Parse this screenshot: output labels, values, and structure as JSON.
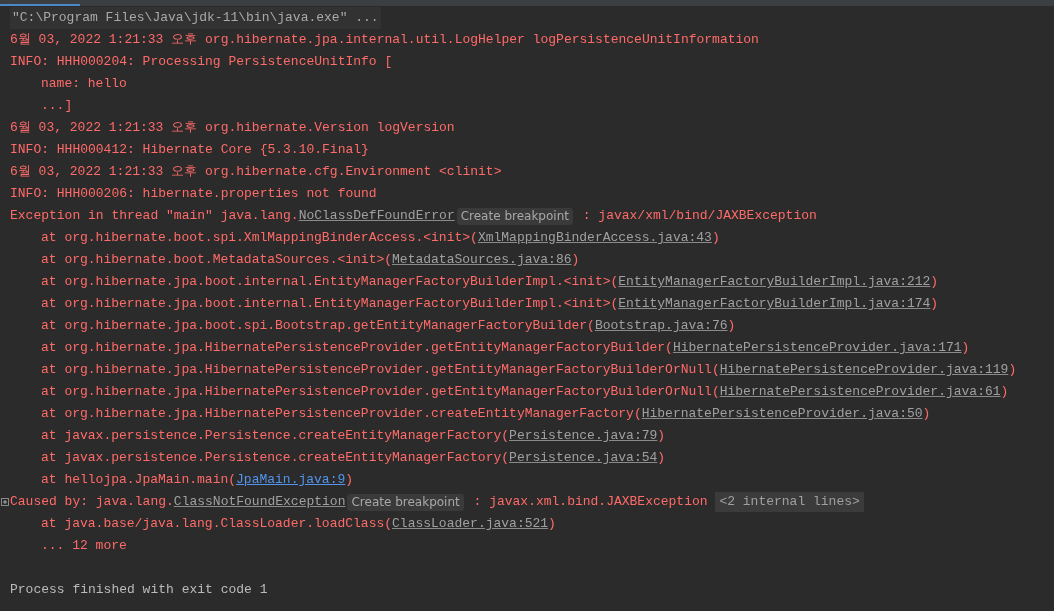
{
  "console": {
    "lines": [
      {
        "kind": "command",
        "parts": [
          {
            "kind": "text",
            "text": "\"C:\\Program Files\\Java\\jdk-11\\bin\\java.exe\" ..."
          }
        ]
      },
      {
        "kind": "error",
        "parts": [
          {
            "kind": "text",
            "text": "6월 03, 2022 1:21:33 오후 org.hibernate.jpa.internal.util.LogHelper logPersistenceUnitInformation"
          }
        ]
      },
      {
        "kind": "error",
        "parts": [
          {
            "kind": "text",
            "text": "INFO: HHH000204: Processing PersistenceUnitInfo ["
          }
        ]
      },
      {
        "kind": "frame",
        "parts": [
          {
            "kind": "text",
            "text": "name: hello"
          }
        ]
      },
      {
        "kind": "frame",
        "parts": [
          {
            "kind": "text",
            "text": "...]"
          }
        ]
      },
      {
        "kind": "error",
        "parts": [
          {
            "kind": "text",
            "text": "6월 03, 2022 1:21:33 오후 org.hibernate.Version logVersion"
          }
        ]
      },
      {
        "kind": "error",
        "parts": [
          {
            "kind": "text",
            "text": "INFO: HHH000412: Hibernate Core {5.3.10.Final}"
          }
        ]
      },
      {
        "kind": "error",
        "parts": [
          {
            "kind": "text",
            "text": "6월 03, 2022 1:21:33 오후 org.hibernate.cfg.Environment <clinit>"
          }
        ]
      },
      {
        "kind": "error",
        "parts": [
          {
            "kind": "text",
            "text": "INFO: HHH000206: hibernate.properties not found"
          }
        ]
      },
      {
        "kind": "error",
        "parts": [
          {
            "kind": "text",
            "text": "Exception in thread \"main\" java.lang."
          },
          {
            "kind": "link",
            "text": "NoClassDefFoundError"
          },
          {
            "kind": "hint",
            "text": "Create breakpoint"
          },
          {
            "kind": "text",
            "text": " : javax/xml/bind/JAXBException"
          }
        ]
      },
      {
        "kind": "frame",
        "parts": [
          {
            "kind": "text",
            "text": "at org.hibernate.boot.spi.XmlMappingBinderAccess.<init>("
          },
          {
            "kind": "link",
            "text": "XmlMappingBinderAccess.java:43"
          },
          {
            "kind": "text",
            "text": ")"
          }
        ]
      },
      {
        "kind": "frame",
        "parts": [
          {
            "kind": "text",
            "text": "at org.hibernate.boot.MetadataSources.<init>("
          },
          {
            "kind": "link",
            "text": "MetadataSources.java:86"
          },
          {
            "kind": "text",
            "text": ")"
          }
        ]
      },
      {
        "kind": "frame",
        "parts": [
          {
            "kind": "text",
            "text": "at org.hibernate.jpa.boot.internal.EntityManagerFactoryBuilderImpl.<init>("
          },
          {
            "kind": "link",
            "text": "EntityManagerFactoryBuilderImpl.java:212"
          },
          {
            "kind": "text",
            "text": ")"
          }
        ]
      },
      {
        "kind": "frame",
        "parts": [
          {
            "kind": "text",
            "text": "at org.hibernate.jpa.boot.internal.EntityManagerFactoryBuilderImpl.<init>("
          },
          {
            "kind": "link",
            "text": "EntityManagerFactoryBuilderImpl.java:174"
          },
          {
            "kind": "text",
            "text": ")"
          }
        ]
      },
      {
        "kind": "frame",
        "parts": [
          {
            "kind": "text",
            "text": "at org.hibernate.jpa.boot.spi.Bootstrap.getEntityManagerFactoryBuilder("
          },
          {
            "kind": "link",
            "text": "Bootstrap.java:76"
          },
          {
            "kind": "text",
            "text": ")"
          }
        ]
      },
      {
        "kind": "frame",
        "parts": [
          {
            "kind": "text",
            "text": "at org.hibernate.jpa.HibernatePersistenceProvider.getEntityManagerFactoryBuilder("
          },
          {
            "kind": "link",
            "text": "HibernatePersistenceProvider.java:171"
          },
          {
            "kind": "text",
            "text": ")"
          }
        ]
      },
      {
        "kind": "frame",
        "parts": [
          {
            "kind": "text",
            "text": "at org.hibernate.jpa.HibernatePersistenceProvider.getEntityManagerFactoryBuilderOrNull("
          },
          {
            "kind": "link",
            "text": "HibernatePersistenceProvider.java:119"
          },
          {
            "kind": "text",
            "text": ")"
          }
        ]
      },
      {
        "kind": "frame",
        "parts": [
          {
            "kind": "text",
            "text": "at org.hibernate.jpa.HibernatePersistenceProvider.getEntityManagerFactoryBuilderOrNull("
          },
          {
            "kind": "link",
            "text": "HibernatePersistenceProvider.java:61"
          },
          {
            "kind": "text",
            "text": ")"
          }
        ]
      },
      {
        "kind": "frame",
        "parts": [
          {
            "kind": "text",
            "text": "at org.hibernate.jpa.HibernatePersistenceProvider.createEntityManagerFactory("
          },
          {
            "kind": "link",
            "text": "HibernatePersistenceProvider.java:50"
          },
          {
            "kind": "text",
            "text": ")"
          }
        ]
      },
      {
        "kind": "frame",
        "parts": [
          {
            "kind": "text",
            "text": "at javax.persistence.Persistence.createEntityManagerFactory("
          },
          {
            "kind": "link",
            "text": "Persistence.java:79"
          },
          {
            "kind": "text",
            "text": ")"
          }
        ]
      },
      {
        "kind": "frame",
        "parts": [
          {
            "kind": "text",
            "text": "at javax.persistence.Persistence.createEntityManagerFactory("
          },
          {
            "kind": "link",
            "text": "Persistence.java:54"
          },
          {
            "kind": "text",
            "text": ")"
          }
        ]
      },
      {
        "kind": "frame",
        "parts": [
          {
            "kind": "text",
            "text": "at hellojpa.JpaMain.main("
          },
          {
            "kind": "project-link",
            "text": "JpaMain.java:9"
          },
          {
            "kind": "text",
            "text": ")"
          }
        ]
      },
      {
        "kind": "error",
        "parts": [
          {
            "kind": "text",
            "text": "Caused by: java.lang."
          },
          {
            "kind": "link",
            "text": "ClassNotFoundException"
          },
          {
            "kind": "hint",
            "text": "Create breakpoint"
          },
          {
            "kind": "text",
            "text": " : javax.xml.bind.JAXBException "
          },
          {
            "kind": "fold",
            "text": "<2 internal lines>"
          }
        ]
      },
      {
        "kind": "frame",
        "parts": [
          {
            "kind": "text",
            "text": "at java.base/java.lang.ClassLoader.loadClass("
          },
          {
            "kind": "link",
            "text": "ClassLoader.java:521"
          },
          {
            "kind": "text",
            "text": ")"
          }
        ]
      },
      {
        "kind": "frame",
        "parts": [
          {
            "kind": "text",
            "text": "... 12 more"
          }
        ]
      },
      {
        "kind": "blank"
      },
      {
        "kind": "plain",
        "parts": [
          {
            "kind": "text",
            "text": "Process finished with exit code 1"
          }
        ]
      }
    ]
  }
}
